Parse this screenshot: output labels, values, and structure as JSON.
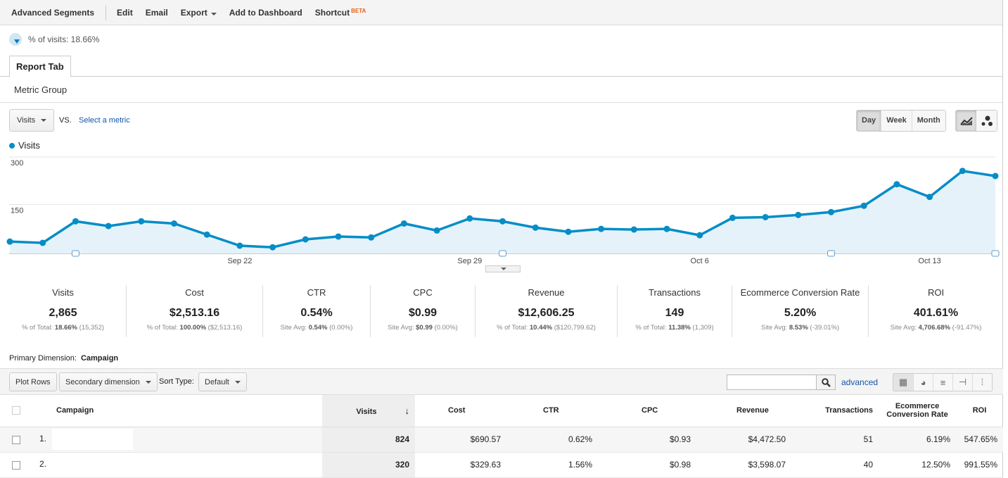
{
  "toolbar": {
    "items": [
      "Advanced Segments",
      "Edit",
      "Email",
      "Export",
      "Add to Dashboard",
      "Shortcut"
    ],
    "beta": "BETA"
  },
  "segment": {
    "label": "% of visits: 18.66%"
  },
  "tabs": {
    "report_tab": "Report Tab",
    "metric_group": "Metric Group"
  },
  "chart_controls": {
    "metric": "Visits",
    "vs": "VS.",
    "select_metric": "Select a metric",
    "periods": [
      "Day",
      "Week",
      "Month"
    ],
    "active_period": "Day",
    "chart_types": [
      "line-chart-icon",
      "motion-chart-icon"
    ]
  },
  "chart_data": {
    "type": "area",
    "series": [
      {
        "name": "Visits",
        "color": "#058dc7",
        "values": [
          33,
          29,
          97,
          82,
          97,
          90,
          55,
          20,
          15,
          40,
          49,
          46,
          90,
          68,
          106,
          97,
          77,
          64,
          73,
          71,
          73,
          53,
          108,
          110,
          117,
          126,
          146,
          214,
          174,
          256,
          240
        ]
      }
    ],
    "x": [
      "Sep 15",
      "Sep 16",
      "Sep 17",
      "Sep 18",
      "Sep 19",
      "Sep 20",
      "Sep 21",
      "Sep 22",
      "Sep 23",
      "Sep 24",
      "Sep 25",
      "Sep 26",
      "Sep 27",
      "Sep 28",
      "Sep 29",
      "Sep 30",
      "Oct 1",
      "Oct 2",
      "Oct 3",
      "Oct 4",
      "Oct 5",
      "Oct 6",
      "Oct 7",
      "Oct 8",
      "Oct 9",
      "Oct 10",
      "Oct 11",
      "Oct 12",
      "Oct 13",
      "Oct 14",
      "Oct 15"
    ],
    "xticks": [
      "Sep 22",
      "Sep 29",
      "Oct 6",
      "Oct 13"
    ],
    "yticks": [
      "300",
      "150"
    ],
    "ylim": [
      0,
      300
    ],
    "grid": true,
    "annotations_at": [
      "Sep 17",
      "Sep 30",
      "Oct 10",
      "Oct 15"
    ],
    "legend": "top-left"
  },
  "scorecards": [
    {
      "label": "Visits",
      "value": "2,865",
      "sub_pre": "% of Total: ",
      "sub_bold": "18.66%",
      "sub_post": " (15,352)"
    },
    {
      "label": "Cost",
      "value": "$2,513.16",
      "sub_pre": "% of Total: ",
      "sub_bold": "100.00%",
      "sub_post": " ($2,513.16)"
    },
    {
      "label": "CTR",
      "value": "0.54%",
      "sub_pre": "Site Avg: ",
      "sub_bold": "0.54%",
      "sub_post": " (0.00%)"
    },
    {
      "label": "CPC",
      "value": "$0.99",
      "sub_pre": "Site Avg: ",
      "sub_bold": "$0.99",
      "sub_post": " (0.00%)"
    },
    {
      "label": "Revenue",
      "value": "$12,606.25",
      "sub_pre": "% of Total: ",
      "sub_bold": "10.44%",
      "sub_post": " ($120,799.62)"
    },
    {
      "label": "Transactions",
      "value": "149",
      "sub_pre": "% of Total: ",
      "sub_bold": "11.38%",
      "sub_post": " (1,309)"
    },
    {
      "label": "Ecommerce Conversion Rate",
      "value": "5.20%",
      "sub_pre": "Site Avg: ",
      "sub_bold": "8.53%",
      "sub_post": " (-39.01%)"
    },
    {
      "label": "ROI",
      "value": "401.61%",
      "sub_pre": "Site Avg: ",
      "sub_bold": "4,706.68%",
      "sub_post": " (-91.47%)"
    }
  ],
  "dimension": {
    "label": "Primary Dimension:",
    "value": "Campaign"
  },
  "table_controls": {
    "plot_rows": "Plot Rows",
    "secondary": "Secondary dimension",
    "sort_label": "Sort Type:",
    "sort_value": "Default",
    "search_value": "",
    "advanced": "advanced"
  },
  "table": {
    "headers": [
      "Campaign",
      "Visits",
      "Cost",
      "CTR",
      "CPC",
      "Revenue",
      "Transactions",
      "Ecommerce Conversion Rate",
      "ROI"
    ],
    "rows": [
      {
        "num": "1.",
        "campaign": "",
        "visits": "824",
        "cost": "$690.57",
        "ctr": "0.62%",
        "cpc": "$0.93",
        "revenue": "$4,472.50",
        "transactions": "51",
        "ecr": "6.19%",
        "roi": "547.65%"
      },
      {
        "num": "2.",
        "campaign": "",
        "visits": "320",
        "cost": "$329.63",
        "ctr": "1.56%",
        "cpc": "$0.98",
        "revenue": "$3,598.07",
        "transactions": "40",
        "ecr": "12.50%",
        "roi": "991.55%"
      }
    ]
  }
}
